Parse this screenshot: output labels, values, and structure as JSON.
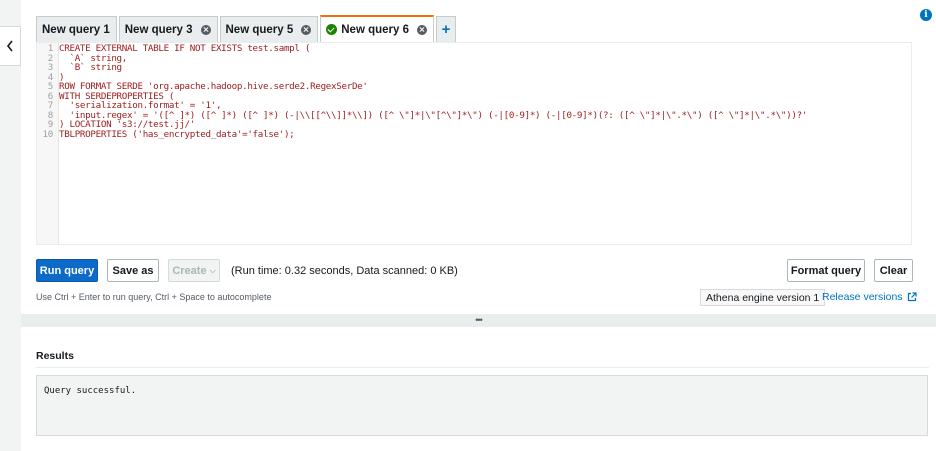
{
  "tabs": [
    {
      "label": "New query 1",
      "closable": false,
      "active": false
    },
    {
      "label": "New query 3",
      "closable": true,
      "active": false
    },
    {
      "label": "New query 5",
      "closable": true,
      "active": false
    },
    {
      "label": "New query 6",
      "closable": true,
      "active": true,
      "status": "success"
    }
  ],
  "add_tab_label": "+",
  "editor": {
    "lines": [
      {
        "n": "1",
        "text": "CREATE EXTERNAL TABLE IF NOT EXISTS test.sampl ("
      },
      {
        "n": "2",
        "text": "  `A` string,"
      },
      {
        "n": "3",
        "text": "  `B` string"
      },
      {
        "n": "4",
        "text": ")"
      },
      {
        "n": "5",
        "text": "ROW FORMAT SERDE 'org.apache.hadoop.hive.serde2.RegexSerDe'"
      },
      {
        "n": "6",
        "text": "WITH SERDEPROPERTIES ("
      },
      {
        "n": "7",
        "text": "  'serialization.format' = '1',"
      },
      {
        "n": "8",
        "text": "  'input.regex' = '([^ ]*) ([^ ]*) ([^ ]*) (-|\\\\[[^\\\\]]*\\\\]) ([^ \\\"]*|\\\"[^\\\"]*\\\") (-|[0-9]*) (-|[0-9]*)(?: ([^ \\\"]*|\\\".*\\\") ([^ \\\"]*|\\\".*\\\"))?'"
      },
      {
        "n": "9",
        "text": ") LOCATION 's3://test.jj/'"
      },
      {
        "n": "10",
        "text": "TBLPROPERTIES ('has_encrypted_data'='false');"
      }
    ]
  },
  "toolbar": {
    "run_label": "Run query",
    "save_label": "Save as",
    "create_label": "Create",
    "run_info": "(Run time: 0.32 seconds, Data scanned: 0 KB)",
    "format_label": "Format query",
    "clear_label": "Clear"
  },
  "hint": "Use Ctrl + Enter to run query, Ctrl + Space to autocomplete",
  "engine_label": "Athena engine version 1",
  "release_label": "Release versions",
  "splitter_label": "•••",
  "results": {
    "title": "Results",
    "message": "Query successful."
  },
  "colors": {
    "primary": "#0e6ac9",
    "active_tab": "#ec7211",
    "success": "#1d8102",
    "link": "#0073bb"
  }
}
